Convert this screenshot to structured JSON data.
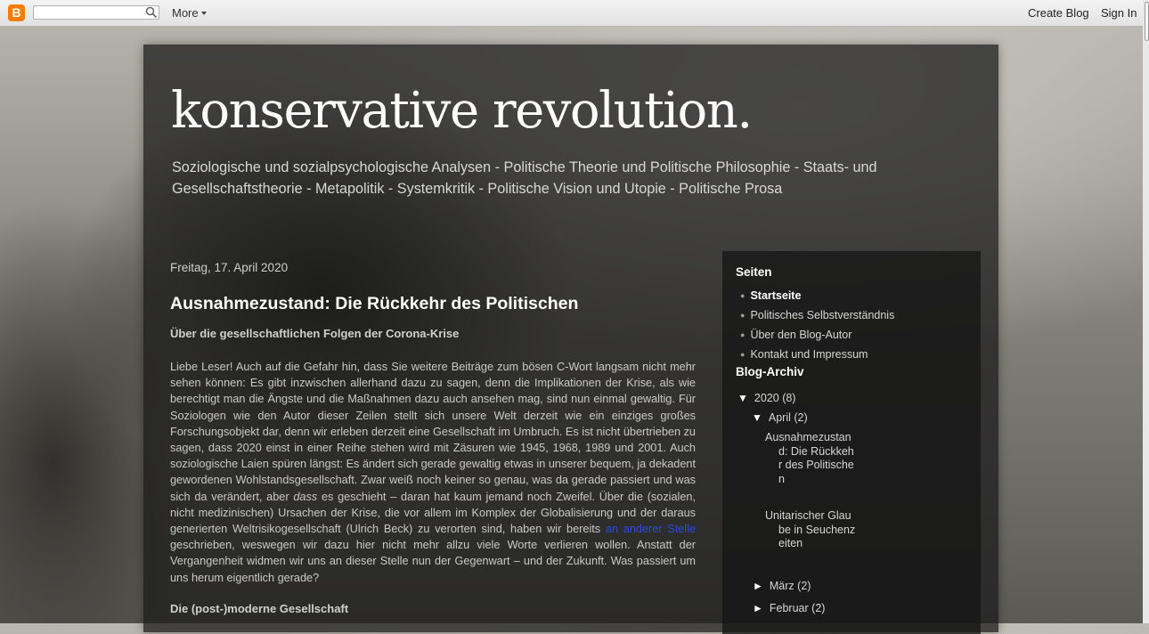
{
  "navbar": {
    "logo_letter": "B",
    "search_value": "",
    "more_label": "More",
    "create_blog_label": "Create Blog",
    "sign_in_label": "Sign In"
  },
  "header": {
    "title": "konservative revolution.",
    "description": "Soziologische und sozialpsychologische Analysen - Politische Theorie und Politische Philosophie - Staats- und Gesellschaftstheorie - Metapolitik - Systemkritik - Politische Vision und Utopie - Politische Prosa"
  },
  "post": {
    "date": "Freitag, 17. April 2020",
    "title": "Ausnahmezustand: Die Rückkehr des Politischen",
    "subtitle": "Über die gesellschaftlichen Folgen der Corona-Krise",
    "body_part1": "Liebe Leser! Auch auf die Gefahr hin, dass Sie weitere Beiträge zum bösen C-Wort langsam nicht mehr sehen können: Es gibt inzwischen allerhand dazu zu sagen, denn die Implikationen der Krise, als wie berechtigt man die Ängste und die Maßnahmen dazu auch ansehen mag, sind nun einmal gewaltig. Für Soziologen wie den Autor dieser Zeilen stellt sich unsere Welt derzeit wie ein einziges großes Forschungsobjekt dar, denn wir erleben derzeit eine Gesellschaft im Umbruch. Es ist nicht übertrieben zu sagen, dass 2020 einst in einer Reihe stehen wird mit Zäsuren wie 1945, 1968, 1989 und 2001. Auch soziologische Laien spüren längst: Es ändert sich gerade gewaltig etwas in unserer bequem, ja dekadent gewordenen Wohlstandsgesellschaft. Zwar weiß noch keiner so genau, was da gerade passiert und was sich da verändert, aber ",
    "body_emph": "dass",
    "body_part2": " es geschieht – daran hat kaum jemand noch Zweifel. Über die (sozialen, nicht medizinischen) Ursachen der Krise, die vor allem im Komplex der Globalisierung und der daraus generierten Weltrisikogesellschaft (Ulrich Beck) zu verorten sind, haben wir bereits ",
    "body_link": "an anderer Stelle",
    "body_part3": " geschrieben, weswegen wir dazu hier nicht mehr allzu viele Worte verlieren wollen. Anstatt der Vergangenheit widmen wir uns an dieser Stelle nun der Gegenwart – und der Zukunft. Was passiert um uns herum eigentlich gerade?",
    "section_heading": "Die (post-)moderne Gesellschaft"
  },
  "sidebar": {
    "pages_heading": "Seiten",
    "pages": [
      {
        "label": "Startseite"
      },
      {
        "label": "Politisches Selbstverständnis"
      },
      {
        "label": "Über den Blog-Autor"
      },
      {
        "label": "Kontakt und Impressum"
      }
    ],
    "archive_heading": "Blog-Archiv",
    "archive": {
      "year": {
        "toggle": "▼",
        "label": "2020",
        "count": "(8)"
      },
      "april": {
        "toggle": "▼",
        "label": "April",
        "count": "(2)"
      },
      "april_posts": [
        {
          "label": "Ausnahmezustand: Die Rückkehr des Politischen"
        },
        {
          "label": "Unitarischer Glaube in Seuchenzeiten"
        }
      ],
      "maerz": {
        "toggle": "►",
        "label": "März",
        "count": "(2)"
      },
      "februar": {
        "toggle": "►",
        "label": "Februar",
        "count": "(2)"
      }
    }
  }
}
